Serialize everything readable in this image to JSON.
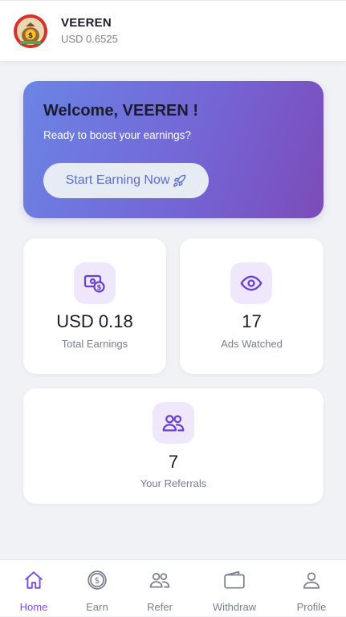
{
  "header": {
    "user_name": "VEEREN",
    "balance": "USD 0.6525"
  },
  "welcome": {
    "title": "Welcome, VEEREN !",
    "subtitle": "Ready to boost your earnings?",
    "cta_label": "Start Earning Now"
  },
  "stats": {
    "total_earnings": {
      "value": "USD 0.18",
      "label": "Total Earnings",
      "icon": "money-icon"
    },
    "ads_watched": {
      "value": "17",
      "label": "Ads Watched",
      "icon": "eye-icon"
    },
    "referrals": {
      "value": "7",
      "label": "Your Referrals",
      "icon": "users-icon"
    }
  },
  "nav": [
    {
      "label": "Home",
      "icon": "home-icon",
      "active": true
    },
    {
      "label": "Earn",
      "icon": "dollar-circle-icon",
      "active": false
    },
    {
      "label": "Refer",
      "icon": "users-icon",
      "active": false
    },
    {
      "label": "Withdraw",
      "icon": "wallet-icon",
      "active": false
    },
    {
      "label": "Profile",
      "icon": "user-icon",
      "active": false
    }
  ],
  "colors": {
    "accent": "#7c4de0",
    "icon_bg": "#efe8fd",
    "gradient_start": "#6b84e6",
    "gradient_end": "#7c4bb9",
    "page_bg": "#f1f2f6"
  }
}
